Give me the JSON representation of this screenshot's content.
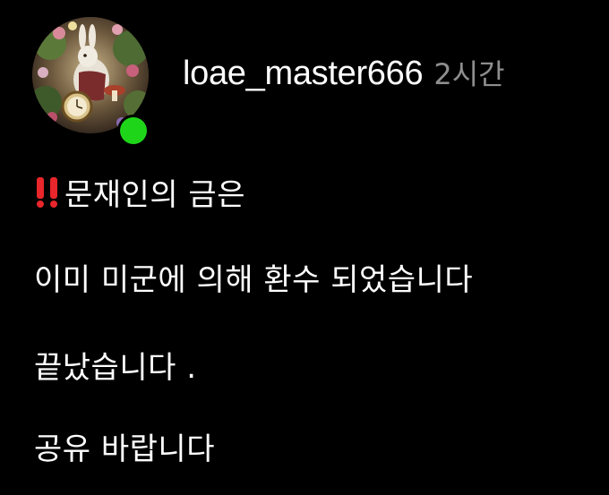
{
  "post": {
    "username": "loae_master666",
    "time": "2시간",
    "avatar_icon": "avatar-image",
    "status_color": "#1fd51a",
    "lines": [
      {
        "prefix_icon": "double-exclamation-icon",
        "text": "문재인의 금은"
      },
      {
        "text": "이미 미군에 의해 환수 되었습니다"
      },
      {
        "text": "끝났습니다 ."
      },
      {
        "text": "공유 바랍니다"
      }
    ]
  },
  "colors": {
    "background": "#000000",
    "text": "#ffffff",
    "muted": "#8e8e8e",
    "exclamation": "#e8262b"
  }
}
